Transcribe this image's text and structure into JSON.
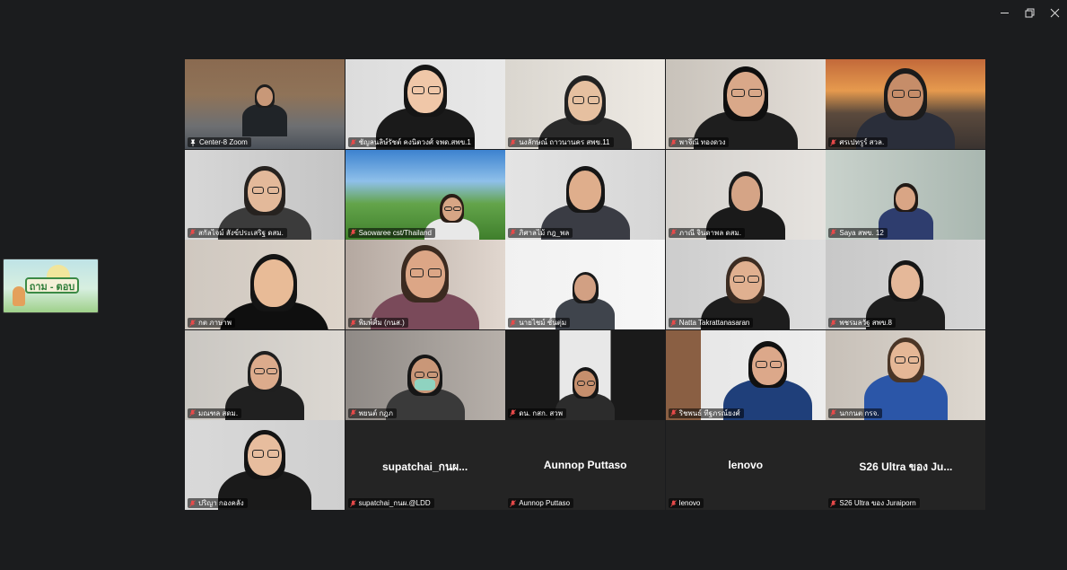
{
  "window_controls": {
    "minimize": "—",
    "restore": "❐",
    "close": "✕"
  },
  "side_thumbnail": {
    "text": "ถาม - ตอบ"
  },
  "participants": [
    {
      "name": "Center-8 Zoom",
      "muted": false,
      "pinned": true,
      "active": true
    },
    {
      "name": "ชัญลนลิษ์รัชต์ คงนิตวงศ์ จพด.สพข.1",
      "muted": true
    },
    {
      "name": "นงลักษณ์ ถาวนานคร สพข.11",
      "muted": true
    },
    {
      "name": "พาจีณี ทองดวง",
      "muted": true
    },
    {
      "name": "ศรเปทรูร์ สวล.",
      "muted": true
    },
    {
      "name": "สกัลไจม์ สังข์ประเสริฐ ดสม.",
      "muted": true
    },
    {
      "name": "Saowaree cst/Thailand",
      "muted": true
    },
    {
      "name": "ภิศาลไม้ กฎ_พล",
      "muted": true
    },
    {
      "name": "ภาณี จินดาพล ดสม.",
      "muted": true
    },
    {
      "name": "Saya สพข. 12",
      "muted": true
    },
    {
      "name": "กต ภาษาพ",
      "muted": true
    },
    {
      "name": "พิมพ์ศิ้ม (กนส.)",
      "muted": true
    },
    {
      "name": "นายไชม์ ชั้นตุ่ม",
      "muted": true
    },
    {
      "name": "Natta Takrattanasaran",
      "muted": true
    },
    {
      "name": "พชรมลวัฐ สพข.8",
      "muted": true
    },
    {
      "name": "มณฑล สดม.",
      "muted": true
    },
    {
      "name": "พยนต์ กฎภ",
      "muted": true
    },
    {
      "name": "ดน. กสก. สวพ",
      "muted": true
    },
    {
      "name": "ริชพนธ์ ทีฐภรณ์ยงศ์",
      "muted": true
    },
    {
      "name": "นกกนต กรจ.",
      "muted": true
    },
    {
      "name": "ปริญา กองคลัง",
      "muted": true
    },
    {
      "name": "supatchai_กนผ.@LDD",
      "display": "supatchai_กนผ...",
      "muted": true,
      "video": false
    },
    {
      "name": "Aunnop Puttaso",
      "display": "Aunnop Puttaso",
      "muted": true,
      "video": false
    },
    {
      "name": "lenovo",
      "display": "lenovo",
      "muted": true,
      "video": false
    },
    {
      "name": "S26 Ultra ของ Juraiporn",
      "display": "S26 Ultra ของ Ju...",
      "muted": true,
      "video": false
    }
  ]
}
